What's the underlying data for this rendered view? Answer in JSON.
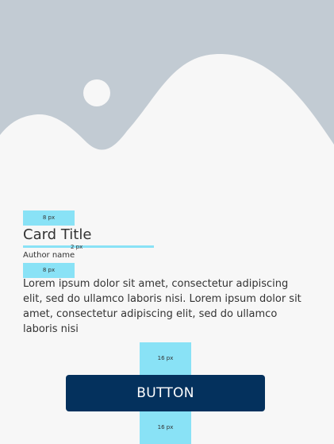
{
  "card": {
    "title": "Card Title",
    "author": "Author name",
    "body": "Lorem ipsum dolor sit amet, consectetur adipiscing elit, sed do ullamco laboris nisi. Lorem ipsum dolor sit amet, consectetur adipiscing elit, sed do ullamco laboris nisi",
    "button_label": "BUTTON"
  },
  "spacing_labels": {
    "top": "8 px",
    "title_gap": "2 px",
    "mid": "8 px",
    "button_top": "16 px",
    "button_bottom": "16 px"
  },
  "icons": {
    "hero": "image-placeholder-icon"
  },
  "colors": {
    "background": "#f7f7f7",
    "placeholder_shape": "#c2cbd3",
    "placeholder_bg": "#f7f7f7",
    "spacer": "#89e2f6",
    "button": "#04315d",
    "text": "#333333"
  }
}
